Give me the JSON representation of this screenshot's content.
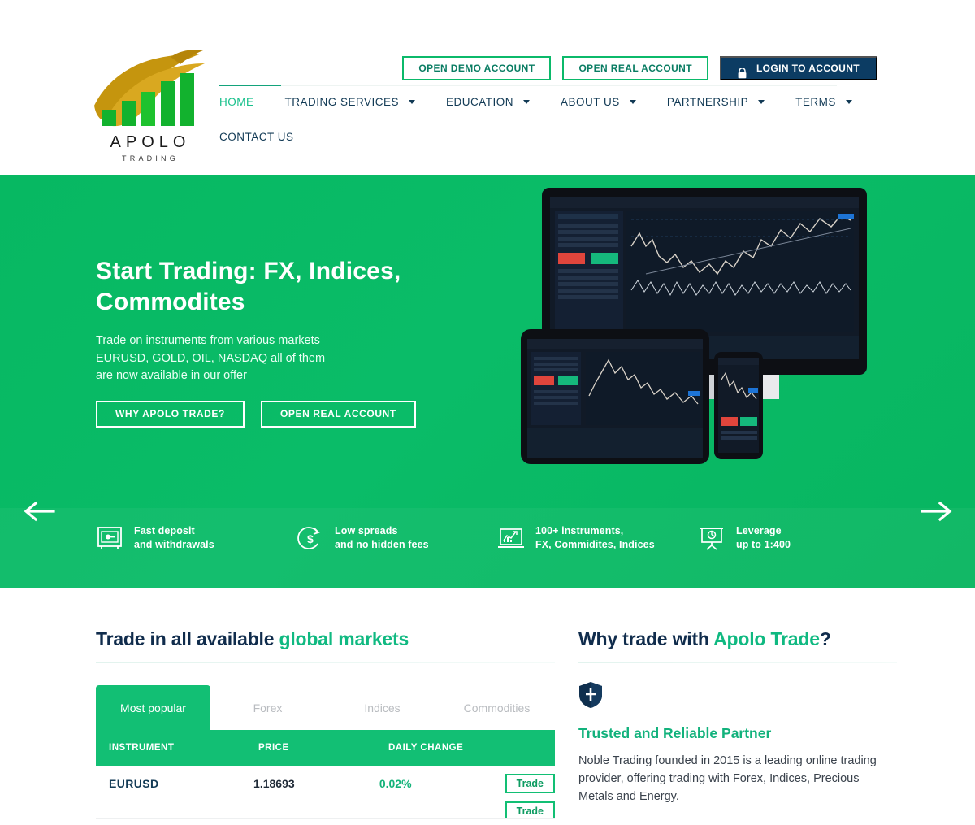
{
  "brand": {
    "name": "APOLO",
    "tagline": "TRADING",
    "colors": {
      "green": "#0bb96a",
      "dark_blue": "#0c3c63",
      "accent_teal": "#17c08b",
      "gold": "#c8960c"
    }
  },
  "header": {
    "top_buttons": [
      {
        "label": "OPEN DEMO ACCOUNT",
        "style": "outline"
      },
      {
        "label": "OPEN REAL ACCOUNT",
        "style": "outline"
      },
      {
        "label": "LOGIN TO ACCOUNT",
        "style": "solid",
        "icon": "lock-icon"
      }
    ],
    "nav": [
      {
        "label": "HOME",
        "active": true,
        "has_dropdown": false
      },
      {
        "label": "TRADING SERVICES",
        "active": false,
        "has_dropdown": true
      },
      {
        "label": "EDUCATION",
        "active": false,
        "has_dropdown": true
      },
      {
        "label": "ABOUT US",
        "active": false,
        "has_dropdown": true
      },
      {
        "label": "PARTNERSHIP",
        "active": false,
        "has_dropdown": true
      },
      {
        "label": "TERMS",
        "active": false,
        "has_dropdown": true
      }
    ],
    "nav_row2": [
      {
        "label": "CONTACT US",
        "active": false,
        "has_dropdown": false
      }
    ]
  },
  "hero": {
    "title": "Start Trading: FX, Indices, Commodites",
    "subtitle_lines": [
      "Trade on instruments from various markets",
      "EURUSD, GOLD, OIL, NASDAQ all of them",
      "are now available in our offer"
    ],
    "buttons": [
      {
        "label": "WHY APOLO TRADE?"
      },
      {
        "label": "OPEN REAL ACCOUNT"
      }
    ],
    "prev_arrow": "arrow-left-icon",
    "next_arrow": "arrow-right-icon",
    "slides_total": 2,
    "slide_active_index": 0,
    "features": [
      {
        "icon": "safe-icon",
        "line1": "Fast deposit",
        "line2": "and withdrawals"
      },
      {
        "icon": "dollar-refresh-icon",
        "line1": "Low spreads",
        "line2": "and no hidden fees"
      },
      {
        "icon": "chart-laptop-icon",
        "line1": "100+ instruments,",
        "line2": "FX, Commidites, Indices"
      },
      {
        "icon": "presentation-icon",
        "line1": "Leverage",
        "line2": "up to 1:400"
      }
    ]
  },
  "markets": {
    "title_plain": "Trade in all available ",
    "title_accent": "global markets",
    "tabs": [
      {
        "label": "Most popular",
        "active": true
      },
      {
        "label": "Forex",
        "active": false
      },
      {
        "label": "Indices",
        "active": false
      },
      {
        "label": "Commodities",
        "active": false
      }
    ],
    "columns": [
      "INSTRUMENT",
      "PRICE",
      "DAILY CHANGE"
    ],
    "action_label": "Trade",
    "rows": [
      {
        "instrument": "EURUSD",
        "price": "1.18693",
        "daily_change": "0.02%",
        "action": "Trade"
      }
    ]
  },
  "why": {
    "title_plain": "Why trade with ",
    "title_accent": "Apolo Trade",
    "title_suffix": "?",
    "icon": "shield-icon",
    "heading": "Trusted and Reliable Partner",
    "body": "Noble Trading founded in 2015  is a leading online trading provider, offering trading with Forex, Indices, Precious Metals and Energy."
  }
}
